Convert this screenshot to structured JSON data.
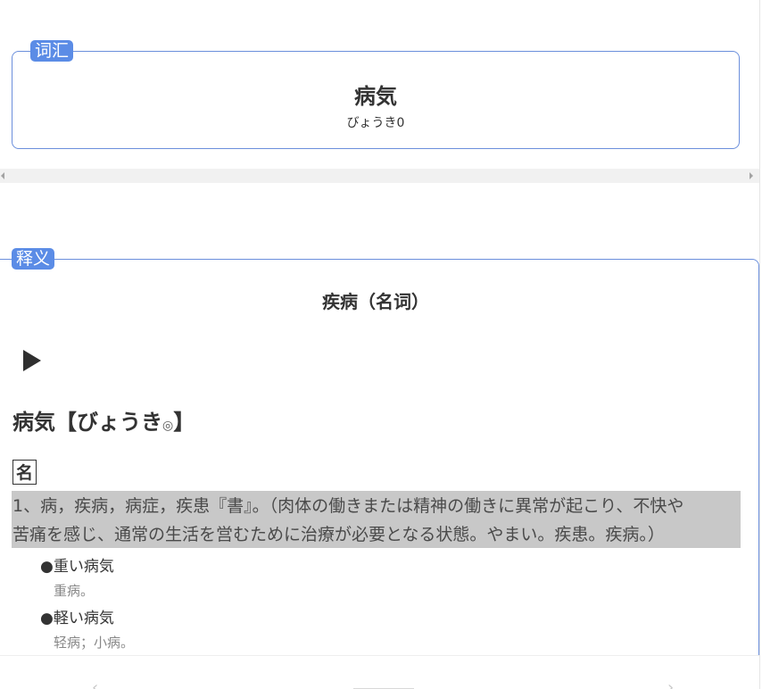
{
  "vocab": {
    "tag": "词汇",
    "word": "病気",
    "reading": "びょうき0"
  },
  "definition": {
    "tag": "释义",
    "title": "疾病（名词）",
    "headword_main": "病気【びょうき",
    "headword_accent": "◎",
    "headword_close": "】",
    "pos": "名",
    "sense_line1": "1、病，疾病，病症，疾患『書』。（肉体の働きまたは精神の働きに異常が起こり、不快や",
    "sense_line2": "苦痛を感じ、通常の生活を営むために治療が必要となる状態。やまい。疾患。疾病。）",
    "examples": [
      {
        "jp": "●重い病気",
        "zh": "重病。"
      },
      {
        "jp": "●軽い病気",
        "zh": "轻病；小病。"
      }
    ]
  },
  "colors": {
    "accent_border": "#6b8fdc",
    "tag_bg": "#5b8ce6",
    "highlight_bg": "#c8c8c8"
  },
  "icons": {
    "play": "play-icon",
    "scroll_left": "arrow-left-icon",
    "scroll_right": "arrow-right-icon"
  }
}
